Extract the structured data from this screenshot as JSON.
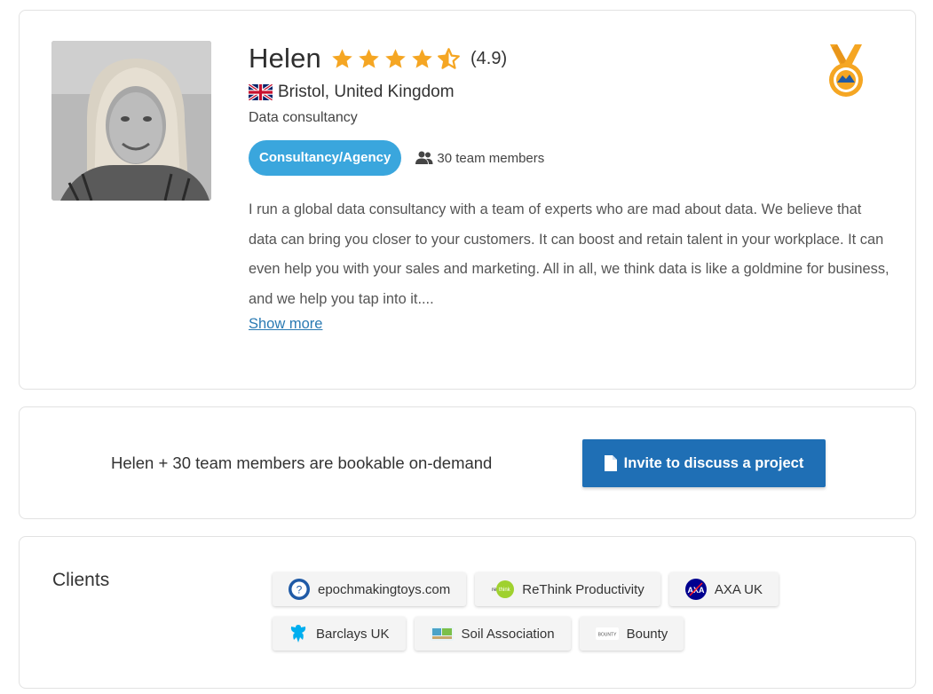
{
  "profile": {
    "name": "Helen",
    "rating_value": 4.5,
    "rating_text": "(4.9)",
    "location": "Bristol, United Kingdom",
    "tagline": "Data consultancy",
    "type_chip": "Consultancy/Agency",
    "team_size": "30 team members",
    "bio": "I run a global data consultancy with a team of experts who are mad about data. We believe that data can bring you closer to your customers. It can boost and retain talent in your workplace. It can even help you with your sales and marketing. All in all, we think data is like a goldmine for business, and we help you tap into it....",
    "show_more": "Show more",
    "star_color": "#f5a623",
    "medal_color": "#f5a623"
  },
  "booking": {
    "text": "Helen + 30 team members are bookable on-demand",
    "button_label": "Invite to discuss a project",
    "button_color": "#1f6fb5"
  },
  "clients": {
    "title": "Clients",
    "items": [
      {
        "name": "epochmakingtoys.com",
        "icon": "question-circle-icon"
      },
      {
        "name": "ReThink Productivity",
        "icon": "rethink-logo-icon"
      },
      {
        "name": "AXA UK",
        "icon": "axa-logo-icon"
      },
      {
        "name": "Barclays UK",
        "icon": "barclays-eagle-icon"
      },
      {
        "name": "Soil Association",
        "icon": "soil-association-logo-icon"
      },
      {
        "name": "Bounty",
        "icon": "bounty-logo-icon"
      }
    ]
  }
}
